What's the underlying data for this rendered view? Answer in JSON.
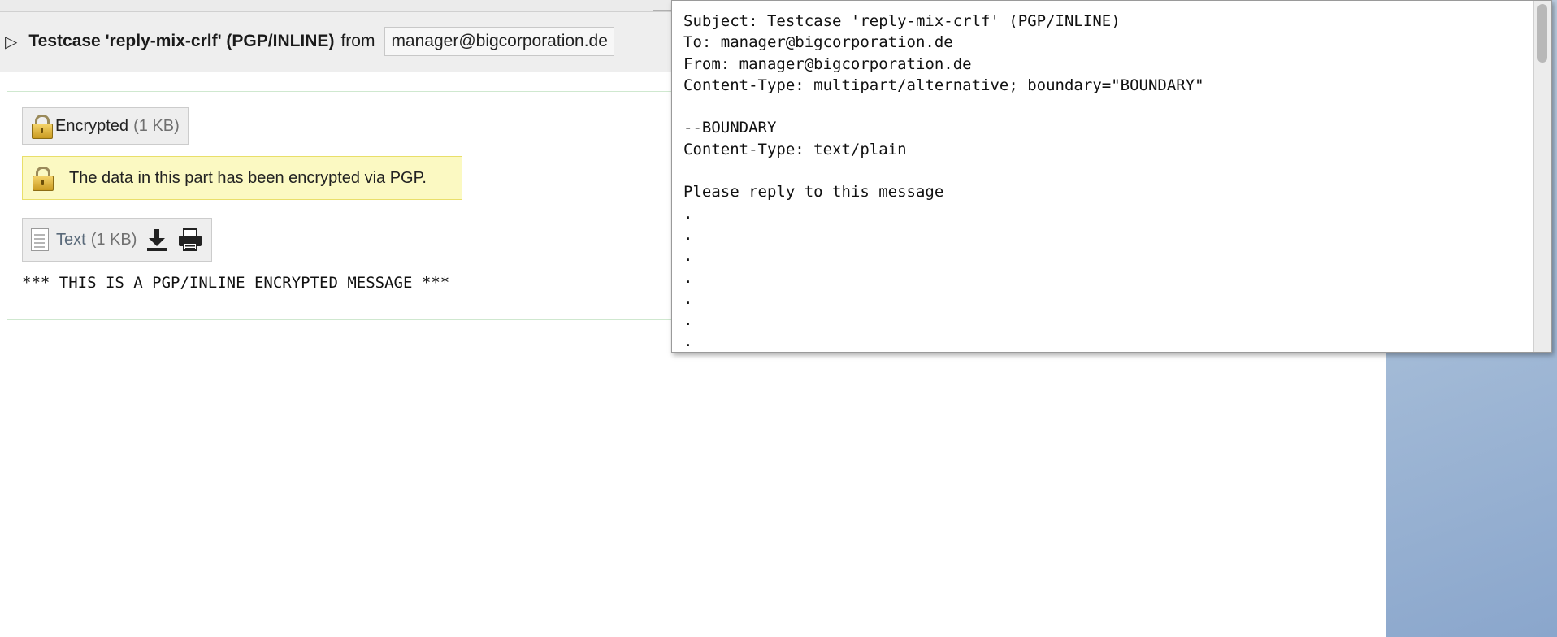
{
  "message": {
    "toggle_glyph": "▷",
    "subject": "Testcase 'reply-mix-crlf' (PGP/INLINE)",
    "from_label": "from",
    "sender": "manager@bigcorporation.de"
  },
  "parts": {
    "encrypted": {
      "label": "Encrypted",
      "size": "(1 KB)",
      "icon": "lock-icon"
    },
    "notice": {
      "text": "The data in this part has been encrypted via PGP.",
      "icon": "lock-icon"
    },
    "text": {
      "label": "Text",
      "size": "(1 KB)",
      "icon": "document-icon",
      "actions": [
        "download-icon",
        "print-icon"
      ]
    }
  },
  "body_text": "*** THIS IS A PGP/INLINE ENCRYPTED MESSAGE ***",
  "source_popup": {
    "lines": [
      "Subject: Testcase 'reply-mix-crlf' (PGP/INLINE)",
      "To: manager@bigcorporation.de",
      "From: manager@bigcorporation.de",
      "Content-Type: multipart/alternative; boundary=\"BOUNDARY\"",
      "",
      "--BOUNDARY",
      "Content-Type: text/plain",
      "",
      "Please reply to this message",
      ".",
      ".",
      ".",
      ".",
      ".",
      ".",
      "."
    ]
  },
  "colors": {
    "notice_bg": "#fbf9c2",
    "notice_border": "#e9df6a",
    "frame_border": "#cfe8cf",
    "desktop": "#a6bdd8"
  }
}
